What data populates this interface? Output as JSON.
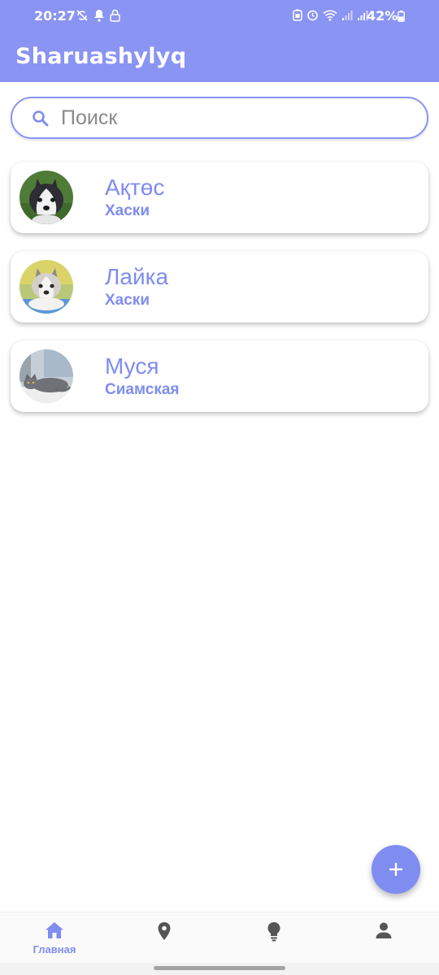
{
  "status_bar": {
    "time": "20:27",
    "battery": "42%"
  },
  "app_bar": {
    "title": "Sharuashylyq"
  },
  "search": {
    "placeholder": "Поиск",
    "value": ""
  },
  "pets": [
    {
      "name": "Ақтөс",
      "breed": "Хаски",
      "photo_icon": "husky-puppy-photo"
    },
    {
      "name": "Лайка",
      "breed": "Хаски",
      "photo_icon": "husky-puppy-white-photo"
    },
    {
      "name": "Муся",
      "breed": "Сиамская",
      "photo_icon": "gray-cat-photo"
    }
  ],
  "fab": {
    "icon": "plus-icon"
  },
  "bottom_nav": {
    "items": [
      {
        "icon": "home-icon",
        "label": "Главная",
        "active": true
      },
      {
        "icon": "location-pin-icon",
        "label": "",
        "active": false
      },
      {
        "icon": "lightbulb-icon",
        "label": "",
        "active": false
      },
      {
        "icon": "person-icon",
        "label": "",
        "active": false
      }
    ]
  },
  "colors": {
    "primary": "#8a94f3",
    "accent_text": "#7f8cf0",
    "inactive_icon": "#555555",
    "background": "#ffffff"
  }
}
